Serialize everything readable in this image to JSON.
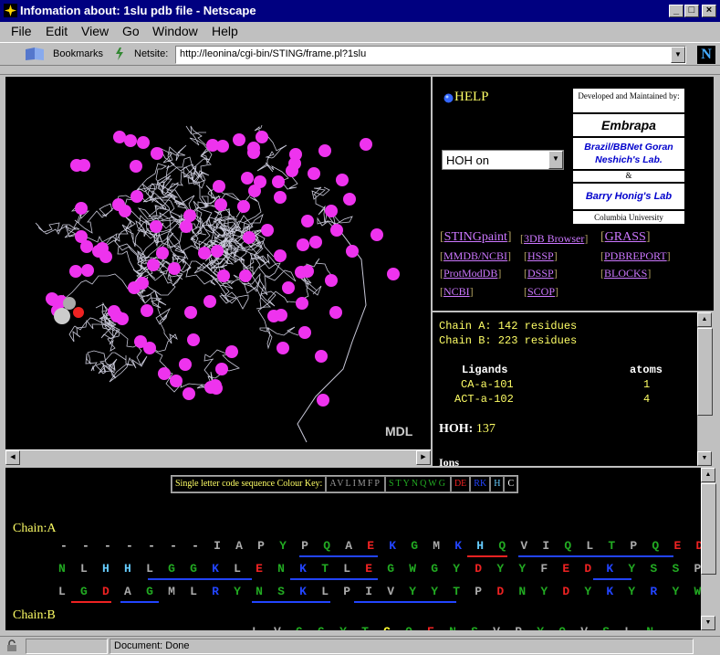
{
  "window": {
    "title": "Infomation about: 1slu pdb file - Netscape"
  },
  "menu": [
    "File",
    "Edit",
    "View",
    "Go",
    "Window",
    "Help"
  ],
  "toolbar": {
    "bookmarks_label": "Bookmarks",
    "netsite_label": "Netsite:",
    "url": "http://leonina/cgi-bin/STING/frame.pl?1slu"
  },
  "viewer": {
    "watermark": "MDL"
  },
  "links": {
    "help": "HELP",
    "hoh_select": "HOH on",
    "items": [
      "STINGpaint",
      "3DB Browser",
      "GRASS",
      "MMDB/NCBI",
      "HSSP",
      "PDBREPORT",
      "ProtModDB",
      "DSSP",
      "BLOCKS",
      "NCBI",
      "SCOP"
    ],
    "credits": {
      "developed": "Developed and Maintained by:",
      "embrapa": "Embrapa",
      "brazil": "Brazil/BBNet Goran Neshich's Lab.",
      "amp": "&",
      "barry": "Barry Honig's Lab",
      "columbia": "Columbia University"
    }
  },
  "info": {
    "chainA": "Chain A: 142 residues",
    "chainB": "Chain B: 223 residues",
    "ligands_hdr": "Ligands",
    "atoms_hdr": "atoms",
    "lig1": "CA-a-101",
    "lig1_atoms": "1",
    "lig2": "ACT-a-102",
    "lig2_atoms": "4",
    "hoh_label": "HOH:",
    "hoh_value": "137",
    "ions": "Ions"
  },
  "sequence": {
    "key_label": "Single letter code sequence Colour Key:",
    "key_groups": [
      "AVLIMFP",
      "STYNQWG",
      "DE",
      "RK",
      "H",
      "C"
    ],
    "chainA_label": "Chain:A",
    "rowA1": "- - - - - - - I A P Y P Q A E K G M K H Q V I Q L T P Q E D E S T L K Y E L L I G Q T L E Y D C",
    "rowA2": "N L H H L G G K L E N K T L E G W G Y D Y Y F E D K Y S S P V S T M M H C P D - - K E E K F Y T A Y",
    "rowA3": "L G D A G M L R Y N S K L P I V Y Y T P D N Y D Y K Y R Y W K A E E K I D N A V V R",
    "chainB_label": "Chain:B",
    "rowB1": "L V G G Y T C Q E N S V P Y Q V S L N - - - S G Y H F C G G S L I N D Q"
  },
  "status": {
    "text": "Document: Done"
  }
}
